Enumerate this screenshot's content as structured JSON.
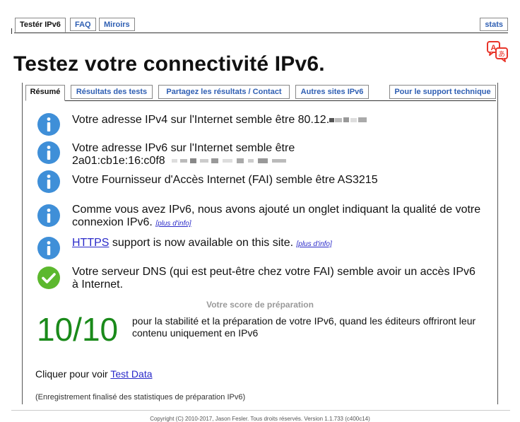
{
  "top_tabs": {
    "tester": "Testér IPv6",
    "faq": "FAQ",
    "mirrors": "Miroirs",
    "stats": "stats"
  },
  "page_title": "Testez votre connectivité IPv6.",
  "inner_tabs": {
    "summary": "Résumé",
    "results": "Résultats des tests",
    "share": "Partagez les résultats / Contact",
    "other_sites": "Autres sites IPv6",
    "support": "Pour le support technique"
  },
  "results": {
    "ipv4": "Votre adresse IPv4 sur l'Internet semble être 80.12.",
    "ipv6_line1": "Votre adresse IPv6 sur l'Internet semble être",
    "ipv6_line2": "2a01:cb1e:16:c0f8",
    "isp": "Votre Fournisseur d'Accès Internet (FAI) semble être AS3215",
    "ipv6_tab": "Comme vous avez IPv6, nous avons ajouté un onglet indiquant la qualité de votre connexion IPv6.",
    "more_info_1": "[plus d'info]",
    "https_link": "HTTPS",
    "https_text": " support is now available on this site.",
    "more_info_2": "[plus d'info]",
    "dns": "Votre serveur DNS (qui est peut-être chez votre FAI) semble avoir un accès IPv6 à Internet."
  },
  "score": {
    "title": "Votre score de préparation",
    "value": "10/10",
    "description": "pour la stabilité et la préparation de votre IPv6, quand les éditeurs offriront leur contenu uniquement en IPv6"
  },
  "test_data": {
    "prefix": "Cliquer pour voir ",
    "link": "Test Data"
  },
  "final_text": "(Enregistrement finalisé des statistiques de préparation IPv6)",
  "copyright": "Copyright (C) 2010-2017, Jason Fesler. Tous droits réservés. Version 1.1.733 (c400c14)",
  "icons": {
    "info": "info-icon",
    "ok": "check-icon",
    "translate": "translate-icon"
  },
  "colors": {
    "info_blue": "#3f8fd8",
    "ok_green": "#5cb82e",
    "score_green": "#1a8a1a",
    "link_blue": "#2a2ac9",
    "translate_red": "#e8352a"
  }
}
